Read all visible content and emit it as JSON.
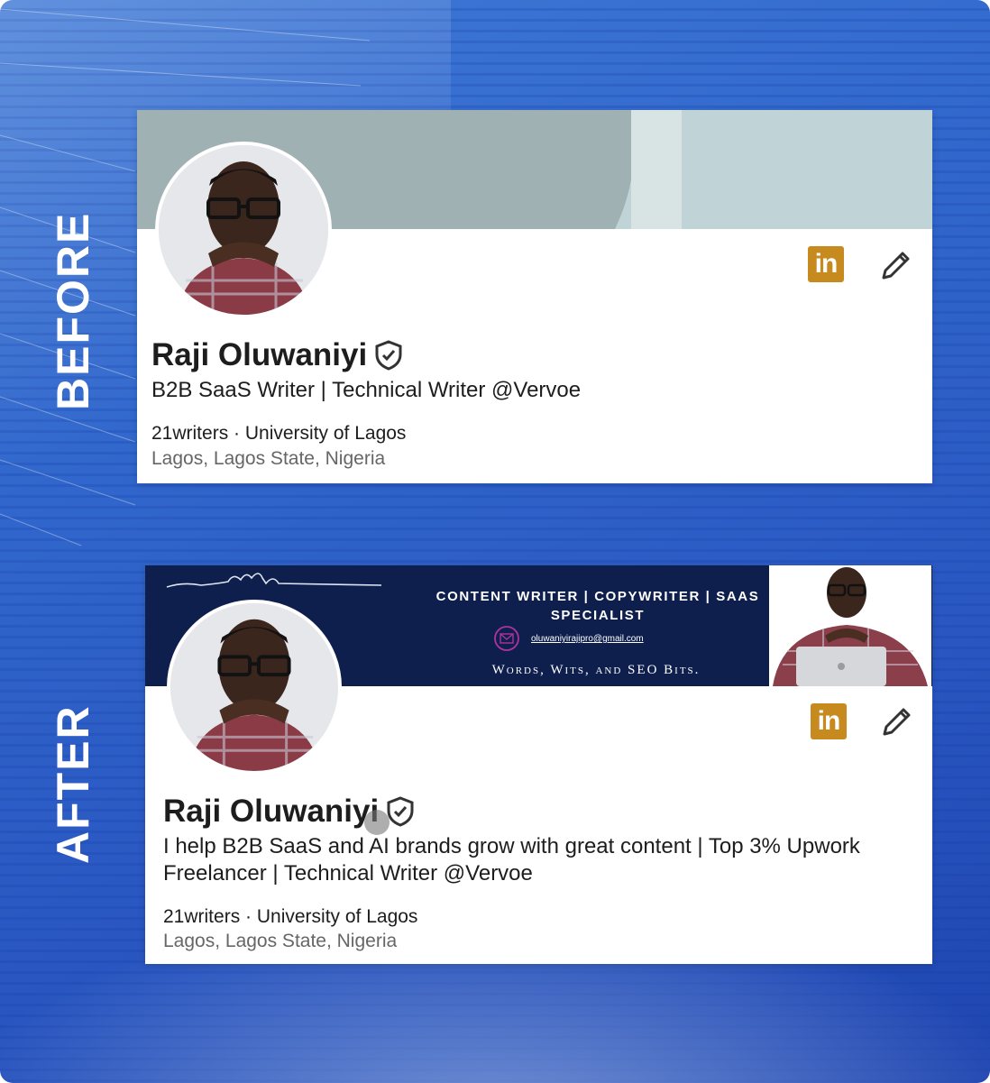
{
  "labels": {
    "before": "BEFORE",
    "after": "AFTER"
  },
  "before": {
    "name": "Raji Oluwaniyi",
    "headline": "B2B SaaS Writer | Technical Writer @Vervoe",
    "company": "21writers · University of Lagos",
    "location": "Lagos, Lagos State, Nigeria",
    "linkedin_glyph": "in"
  },
  "after": {
    "name": "Raji Oluwaniyi",
    "headline": "I help B2B SaaS and AI brands grow with great content | Top 3% Upwork Freelancer | Technical Writer @Vervoe",
    "company": "21writers · University of Lagos",
    "location": "Lagos, Lagos State, Nigeria",
    "linkedin_glyph": "in",
    "banner": {
      "title_line1": "CONTENT WRITER | COPYWRITER | SAAS",
      "title_line2": "SPECIALIST",
      "email": "oluwaniyirajipro@gmail.com",
      "tagline": "Words, Wits, and SEO Bits."
    }
  },
  "colors": {
    "background": "#3167cc",
    "linkedin_button": "#c78a1e",
    "before_banner": "#a0b1b3",
    "after_banner": "#0e1f4d"
  },
  "icons": [
    "verified-shield-icon",
    "linkedin-icon",
    "pencil-icon",
    "email-icon"
  ]
}
